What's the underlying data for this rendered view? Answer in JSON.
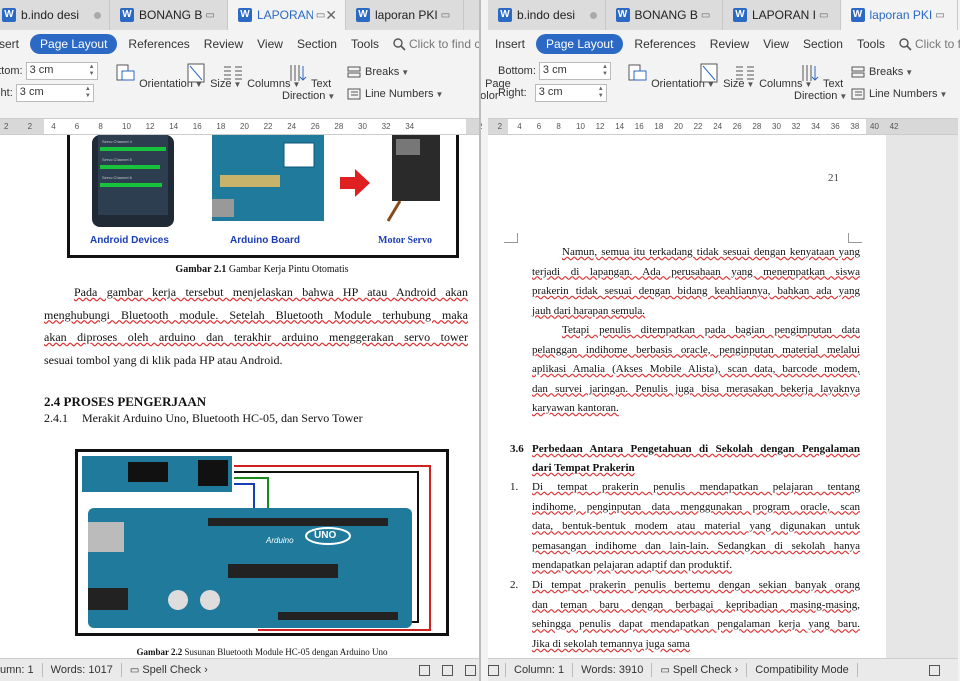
{
  "left": {
    "tabs": [
      {
        "label": "b.indo desi",
        "active": false
      },
      {
        "label": "BONANG B",
        "active": false
      },
      {
        "label": "LAPORAN I",
        "active": true
      },
      {
        "label": "laporan PKI",
        "active": false
      }
    ],
    "menu": [
      "sert",
      "Page Layout",
      "References",
      "Review",
      "View",
      "Section",
      "Tools"
    ],
    "find_placeholder": "Click to find cc",
    "margins": {
      "bottom_label": "ottom:",
      "bottom_value": "3 cm",
      "right_label": "ight:",
      "right_value": "3 cm"
    },
    "ribbon": {
      "orientation": "Orientation",
      "size": "Size",
      "columns": "Columns",
      "text_direction_1": "Text",
      "text_direction_2": "Direction",
      "breaks": "Breaks",
      "line_numbers": "Line Numbers"
    },
    "ruler": [
      "2",
      "2",
      "4",
      "6",
      "8",
      "10",
      "12",
      "14",
      "16",
      "18",
      "20",
      "22",
      "24",
      "26",
      "28",
      "30",
      "32",
      "34"
    ],
    "figure1": {
      "labels": [
        "Android Devices",
        "Arduino Board",
        "Motor Servo"
      ],
      "phone_rows": [
        "Servo Channel 4",
        "Servo Channel 5",
        "Servo Channel 6"
      ]
    },
    "caption1_bold": "Gambar 2.1",
    "caption1_rest": "Gambar Kerja Pintu Otomatis",
    "para1": [
      "Pada gambar kerja tersebut menjelaskan bahwa HP atau Android akan",
      "menghubungi Bluetooth module. Setelah Bluetooth Module terhubung maka",
      "akan diproses oleh arduino dan terakhir arduino menggerakan servo tower",
      "sesuai tombol yang di klik pada HP atau Android."
    ],
    "heading": "2.4 PROSES PENGERJAAN",
    "subheading_num": "2.4.1",
    "subheading": "Merakit Arduino Uno, Bluetooth HC-05, dan Servo Tower",
    "board_text": [
      "UNO",
      "Arduino"
    ],
    "caption2_bold": "Gambar 2.2",
    "caption2_rest": "Susunan Bluetooth Module HC-05 dengan Arduino Uno",
    "status": {
      "column": "umn: 1",
      "words": "Words: 1017",
      "spell": "Spell Check"
    }
  },
  "right": {
    "tabs": [
      {
        "label": "b.indo desi",
        "active": false
      },
      {
        "label": "BONANG B",
        "active": false
      },
      {
        "label": "LAPORAN I",
        "active": false
      },
      {
        "label": "laporan PKI",
        "active": true
      }
    ],
    "menu": [
      "Insert",
      "Page Layout",
      "References",
      "Review",
      "View",
      "Section",
      "Tools"
    ],
    "find_placeholder": "Click to fin",
    "margins": {
      "bottom_label": "Bottom:",
      "bottom_value": "3 cm",
      "right_label": "Right:",
      "right_value": "3 cm"
    },
    "ribbon": {
      "page_color_1": "Page",
      "page_color_2": "Color",
      "orientation": "Orientation",
      "size": "Size",
      "columns": "Columns",
      "text_direction_1": "Text",
      "text_direction_2": "Direction",
      "breaks": "Breaks",
      "line_numbers": "Line Numbers"
    },
    "ruler": [
      "2",
      "2",
      "4",
      "6",
      "8",
      "10",
      "12",
      "14",
      "16",
      "18",
      "20",
      "22",
      "24",
      "26",
      "28",
      "30",
      "32",
      "34",
      "36",
      "38",
      "40",
      "42"
    ],
    "page_number": "21",
    "para1": [
      "Namun, semua itu terkadang tidak sesuai dengan kenyataan yang",
      "terjadi di lapangan. Ada perusahaan yang menempatkan siswa",
      "prakerin tidak sesuai dengan bidang keahliannya, bahkan ada yang",
      "jauh dari harapan semula."
    ],
    "para2": [
      "Tetapi penulis ditempatkan pada bagian pengimputan data",
      "pelanggan indihome berbasis oracle, penginputan material melalui",
      "aplikasi Amalia (Akses Mobile Alista), scan data, barcode modem,",
      "dan survei jaringan. Penulis juga bisa merasakan bekerja layaknya",
      "karyawan kantoran."
    ],
    "heading_num": "3.6",
    "heading_1": "Perbedaan Antara Pengetahuan di Sekolah dengan Pengalaman",
    "heading_2": "dari Tempat Prakerin",
    "item1_num": "1.",
    "item1": [
      "Di tempat prakerin penulis mendapatkan pelajaran tentang",
      "indihome, penginputan data menggunakan program oracle, scan",
      "data, bentuk-bentuk modem atau material yang digunakan untuk",
      "pemasangan indihome dan lain-lain. Sedangkan di sekolah hanya",
      "mendapatkan pelajaran adaptif dan produktif."
    ],
    "item2_num": "2.",
    "item2": [
      "Di tempat prakerin penulis bertemu dengan sekian banyak orang",
      "dan teman baru dengan berbagai kepribadian masing-masing,",
      "sehingga penulis dapat mendapatkan pengalaman kerja yang baru.",
      "Jika di sekolah temannya juga sama"
    ],
    "status": {
      "column": "Column: 1",
      "words": "Words: 3910",
      "spell": "Spell Check",
      "compat": "Compatibility Mode"
    }
  },
  "colors": {
    "accent": "#2b69c4",
    "arduino": "#1f7a9c",
    "arrow": "#e02020"
  }
}
